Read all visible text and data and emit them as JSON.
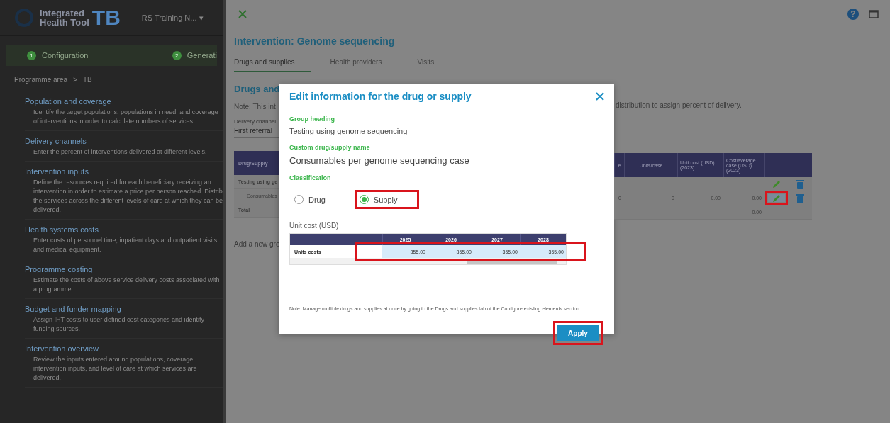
{
  "sidebar": {
    "logo": {
      "line1": "Integrated",
      "line2": "Health Tool",
      "program": "TB"
    },
    "project": {
      "name": "RS Training N...",
      "caret": "▾"
    },
    "steps": [
      {
        "number": "1",
        "label": "Configuration"
      },
      {
        "number": "2",
        "label": "Generati"
      }
    ],
    "breadcrumb": {
      "area": "Programme area",
      "separator": ">",
      "current": "TB"
    },
    "sections": [
      {
        "title": "Population and coverage",
        "description": "Identify the target populations, populations in need, and coverage of interventions in order to calculate numbers of services."
      },
      {
        "title": "Delivery channels",
        "description": "Enter the percent of interventions delivered at different levels."
      },
      {
        "title": "Intervention inputs",
        "description": "Define the resources required for each beneficiary receiving an intervention in order to estimate a price per person reached. Distrib the services across the different levels of care at which they can be delivered."
      },
      {
        "title": "Health systems costs",
        "description": "Enter costs of personnel time, inpatient days and outpatient visits, and medical equipment."
      },
      {
        "title": "Programme costing",
        "description": "Estimate the costs of above service delivery costs associated with a programme."
      },
      {
        "title": "Budget and funder mapping",
        "description": "Assign IHT costs to user defined cost categories and identify funding sources."
      },
      {
        "title": "Intervention overview",
        "description": "Review the inputs entered around populations, coverage, intervention inputs, and level of care at which services are delivered."
      }
    ]
  },
  "top_bar": {
    "help": "?"
  },
  "intervention": {
    "title": "Intervention: Genome sequencing",
    "tabs": [
      {
        "label": "Drugs and supplies",
        "selected": true
      },
      {
        "label": "Health providers",
        "selected": false
      },
      {
        "label": "Visits",
        "selected": false
      }
    ],
    "heading": "Drugs and",
    "note_start": "Note: This int",
    "note_end": "distribution to assign percent of delivery.",
    "delivery_channel": {
      "label": "Delivery channel",
      "value": "First referral"
    },
    "table_left": {
      "header": "Drug/Supply",
      "rows": [
        {
          "kind": "group",
          "text": "Testing using ge"
        },
        {
          "kind": "item",
          "text": "Consumables"
        },
        {
          "kind": "total",
          "text": "Total"
        }
      ]
    },
    "table_right": {
      "columns": [
        "e",
        "Units/case",
        "Unit cost (USD) (2023)",
        "Cost/average case (USD) (2023)"
      ],
      "rows": [
        {
          "cells": [
            "",
            "",
            "",
            ""
          ],
          "actions": true,
          "highlighted": false
        },
        {
          "cells": [
            "0",
            "0",
            "0.00",
            "0.00"
          ],
          "actions": true,
          "highlighted": true
        },
        {
          "cells": [
            "",
            "",
            "",
            "0.00"
          ],
          "actions": false
        }
      ]
    },
    "add_group": "Add a new gro"
  },
  "modal": {
    "title": "Edit information for the drug or supply",
    "fields": [
      {
        "label": "Group heading",
        "value": "Testing using genome sequencing",
        "kind": "plain"
      },
      {
        "label": "Custom drug/supply name",
        "value": "Consumables per genome sequencing case",
        "kind": "large"
      }
    ],
    "classification": {
      "label": "Classification",
      "options": [
        {
          "label": "Drug",
          "selected": false,
          "highlighted": false
        },
        {
          "label": "Supply",
          "selected": true,
          "highlighted": true
        }
      ]
    },
    "unit_cost": {
      "label": "Unit cost (USD)",
      "years": [
        "2025",
        "2026",
        "2027",
        "2028"
      ],
      "rows": [
        {
          "label": "Units costs",
          "values": [
            "355.00",
            "355.00",
            "355.00",
            "355.00"
          ],
          "highlighted": true
        }
      ]
    },
    "note": "Note: Manage multiple drugs and supplies at once by going to the Drugs and supplies tab of the Configure existing elements section.",
    "apply": {
      "label": "Apply",
      "highlighted": true
    }
  }
}
